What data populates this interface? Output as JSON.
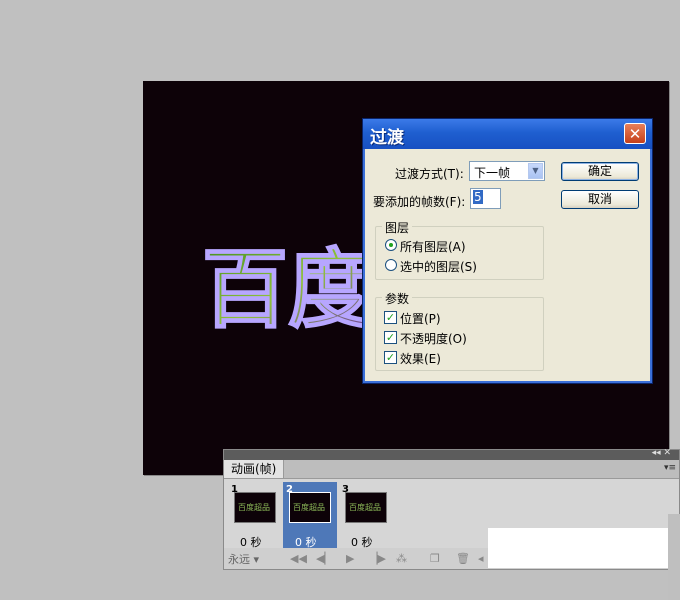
{
  "dialog": {
    "title": "过渡",
    "transition_label": "过渡方式(T):",
    "transition_value": "下一帧",
    "frames_label": "要添加的帧数(F):",
    "frames_value": "5",
    "ok_label": "确定",
    "cancel_label": "取消",
    "layers_group": {
      "title": "图层",
      "options": [
        "所有图层(A)",
        "选中的图层(S)"
      ],
      "selected": "所有图层(A)"
    },
    "params_group": {
      "title": "参数",
      "options": [
        "位置(P)",
        "不透明度(O)",
        "效果(E)"
      ],
      "checked": [
        true,
        true,
        true
      ]
    }
  },
  "canvas": {
    "text": "百度"
  },
  "animation_panel": {
    "tab_label": "动画(帧)",
    "frames": [
      {
        "number": "1",
        "delay": "0 秒",
        "thumb_text": "百度超品"
      },
      {
        "number": "2",
        "delay": "0 秒",
        "thumb_text": "百度超品",
        "selected": true
      },
      {
        "number": "3",
        "delay": "0 秒",
        "thumb_text": "百度超品"
      }
    ],
    "loop_label": "永远",
    "controls": [
      "first-frame-icon",
      "prev-frame-icon",
      "play-icon",
      "next-frame-icon",
      "tween-icon",
      "new-frame-icon",
      "delete-frame-icon"
    ]
  },
  "colors": {
    "titlebar": "#1f5fd0",
    "dialog_bg": "#ece9d8",
    "canvas_bg": "#0d0208"
  }
}
